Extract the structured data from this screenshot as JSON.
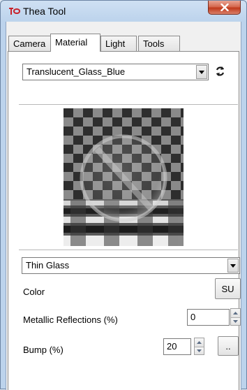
{
  "window": {
    "title": "Thea Tool",
    "close_glyph": "✕"
  },
  "tabs": [
    {
      "label": "Camera",
      "active": false
    },
    {
      "label": "Material",
      "active": true
    },
    {
      "label": "Light",
      "active": false
    },
    {
      "label": "Tools",
      "active": false
    }
  ],
  "material": {
    "selected": "Translucent_Glass_Blue",
    "refresh_icon": "refresh-icon",
    "preview_icon": "checkerboard-glass-sphere-preview",
    "type_selected": "Thin Glass"
  },
  "properties": {
    "color_label": "Color",
    "color_button": "SU",
    "metallic_label": "Metallic Reflections (%)",
    "metallic_value": "0",
    "bump_label": "Bump (%)",
    "bump_value": "20",
    "bump_button": ".."
  },
  "colors": {
    "accent_close": "#c0391b",
    "title_bg": "#bcd3ec",
    "panel_bg": "#ffffff"
  }
}
